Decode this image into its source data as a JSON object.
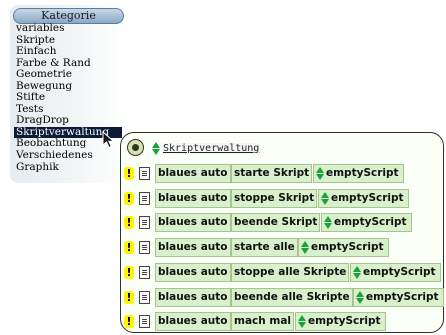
{
  "category_panel": {
    "header": "Kategorie",
    "items": [
      "variables",
      "Skripte",
      "Einfach",
      "Farbe & Rand",
      "Geometrie",
      "Bewegung",
      "Stifte",
      "Tests",
      "DragDrop",
      "Skriptverwaltung",
      "Beobachtung",
      "Verschiedenes",
      "Graphik"
    ],
    "selected": "Skriptverwaltung"
  },
  "script_panel": {
    "title": "Skriptverwaltung",
    "rows": [
      {
        "object": "blaues auto",
        "command": "starte Skript",
        "arg": "emptyScript"
      },
      {
        "object": "blaues auto",
        "command": "stoppe Skript",
        "arg": "emptyScript"
      },
      {
        "object": "blaues auto",
        "command": "beende Skript",
        "arg": "emptyScript"
      },
      {
        "object": "blaues auto",
        "command": "starte alle",
        "arg": "emptyScript"
      },
      {
        "object": "blaues auto",
        "command": "stoppe alle Skripte",
        "arg": "emptyScript"
      },
      {
        "object": "blaues auto",
        "command": "beende alle Skripte",
        "arg": "emptyScript"
      },
      {
        "object": "blaues auto",
        "command": "mach mal",
        "arg": "emptyScript"
      }
    ]
  },
  "colors": {
    "selected_bg": "#0c1b38",
    "chip_bg": "#d9f0cc",
    "bang_yellow": "#fff400",
    "arrow_green": "#1aa13a"
  }
}
